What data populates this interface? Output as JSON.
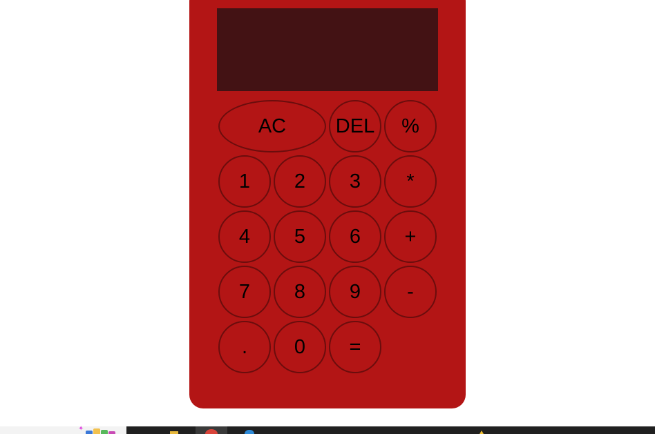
{
  "display": {
    "value": ""
  },
  "keys": [
    {
      "label": "AC",
      "name": "all-clear-button",
      "wide": true
    },
    {
      "label": "DEL",
      "name": "delete-button"
    },
    {
      "label": "%",
      "name": "percent-button"
    },
    {
      "label": "1",
      "name": "digit-1-button"
    },
    {
      "label": "2",
      "name": "digit-2-button"
    },
    {
      "label": "3",
      "name": "digit-3-button"
    },
    {
      "label": "*",
      "name": "multiply-button"
    },
    {
      "label": "4",
      "name": "digit-4-button"
    },
    {
      "label": "5",
      "name": "digit-5-button"
    },
    {
      "label": "6",
      "name": "digit-6-button"
    },
    {
      "label": "+",
      "name": "add-button"
    },
    {
      "label": "7",
      "name": "digit-7-button"
    },
    {
      "label": "8",
      "name": "digit-8-button"
    },
    {
      "label": "9",
      "name": "digit-9-button"
    },
    {
      "label": "-",
      "name": "subtract-button"
    },
    {
      "label": ".",
      "name": "decimal-button"
    },
    {
      "label": "0",
      "name": "digit-0-button"
    },
    {
      "label": "=",
      "name": "equals-button"
    }
  ],
  "taskbar": {
    "icons": [
      "sparkle-icon",
      "widgets-icon",
      "file-explorer-icon",
      "chrome-icon",
      "edge-icon",
      "notification-icon"
    ]
  },
  "colors": {
    "calculator_body": "#b31515",
    "display_background": "#431214",
    "key_border": "#6b0d0d",
    "key_text": "#000000",
    "page_background": "#ffffff",
    "taskbar": "#202020"
  }
}
